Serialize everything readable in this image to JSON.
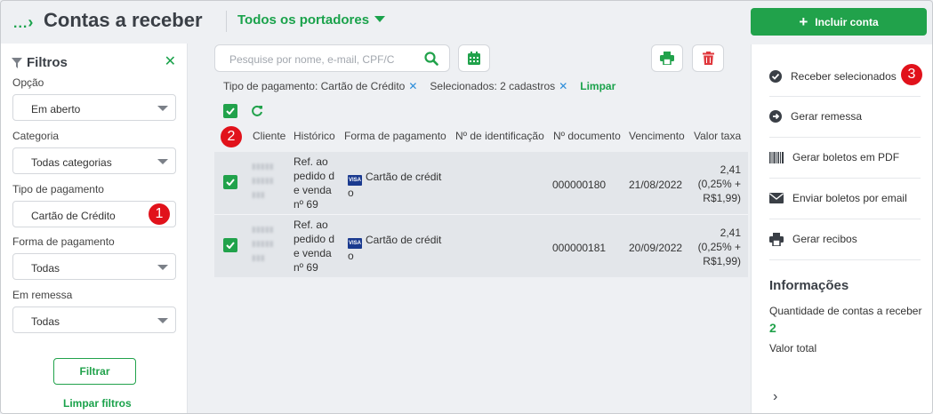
{
  "header": {
    "breadcrumb": "...",
    "title": "Contas a receber",
    "portador": "Todos os portadores",
    "include_button": "Incluir conta"
  },
  "filters": {
    "title": "Filtros",
    "fields": [
      {
        "label": "Opção",
        "value": "Em aberto"
      },
      {
        "label": "Categoria",
        "value": "Todas categorias"
      },
      {
        "label": "Tipo de pagamento",
        "value": "Cartão de Crédito"
      },
      {
        "label": "Forma de pagamento",
        "value": "Todas"
      },
      {
        "label": "Em remessa",
        "value": "Todas"
      }
    ],
    "apply_button": "Filtrar",
    "clear_link": "Limpar filtros"
  },
  "search": {
    "placeholder": "Pesquise por nome, e-mail, CPF/C"
  },
  "chips": {
    "payment_type": "Tipo de pagamento: Cartão de Crédito",
    "selected": "Selecionados: 2 cadastros",
    "clear": "Limpar"
  },
  "table": {
    "columns": [
      "Cliente",
      "Histórico",
      "Forma de pagamento",
      "Nº de identificação",
      "Nº documento",
      "Vencimento",
      "Valor taxa"
    ],
    "rows": [
      {
        "checked": true,
        "historico": [
          "Ref. ao",
          "pedido d",
          "e venda",
          "nº 69"
        ],
        "forma": [
          "Cartão de crédit",
          "o"
        ],
        "documento": "000000180",
        "vencimento": "21/08/2022",
        "taxa": [
          "2,41",
          "(0,25% +",
          "R$1,99)"
        ]
      },
      {
        "checked": true,
        "historico": [
          "Ref. ao",
          "pedido d",
          "e venda",
          "nº 69"
        ],
        "forma": [
          "Cartão de crédit",
          "o"
        ],
        "documento": "000000181",
        "vencimento": "20/09/2022",
        "taxa": [
          "2,41",
          "(0,25% +",
          "R$1,99)"
        ]
      }
    ]
  },
  "actions": {
    "items": [
      {
        "label": "Receber selecionados",
        "icon": "check-circle-icon"
      },
      {
        "label": "Gerar remessa",
        "icon": "arrow-right-circle-icon"
      },
      {
        "label": "Gerar boletos em PDF",
        "icon": "barcode-icon"
      },
      {
        "label": "Enviar boletos por email",
        "icon": "envelope-icon"
      },
      {
        "label": "Gerar recibos",
        "icon": "printer-icon"
      }
    ]
  },
  "info": {
    "title": "Informações",
    "count_label": "Quantidade de contas a receber",
    "count_value": "2",
    "total_label": "Valor total"
  },
  "badges": [
    "1",
    "2",
    "3"
  ],
  "colors": {
    "accent": "#21a24b",
    "badge": "#e1121b",
    "delete": "#e0393e",
    "row_bg": "#e3e6ea"
  }
}
